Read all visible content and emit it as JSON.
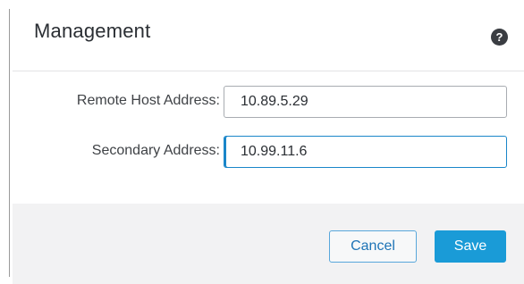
{
  "dialog": {
    "title": "Management",
    "help_icon": "question-mark-icon"
  },
  "form": {
    "fields": [
      {
        "label": "Remote Host Address:",
        "value": "10.89.5.29"
      },
      {
        "label": "Secondary Address:",
        "value": "10.99.11.6"
      }
    ]
  },
  "footer": {
    "cancel_label": "Cancel",
    "save_label": "Save"
  },
  "colors": {
    "accent": "#1a9bd7",
    "focus_border": "#1a86c9",
    "footer_background": "#f2f2f3",
    "title_text": "#2a2e33"
  }
}
